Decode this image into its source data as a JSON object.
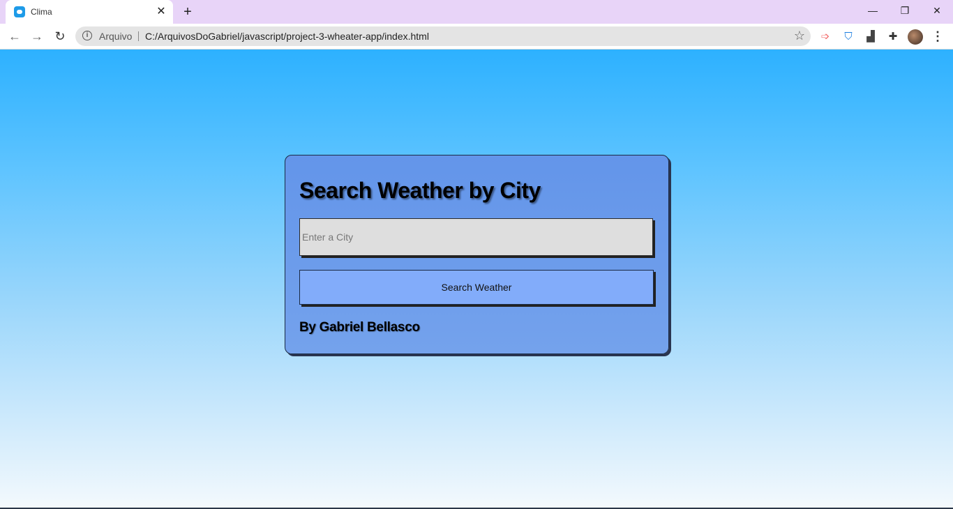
{
  "browser": {
    "tab_title": "Clima",
    "tab_close": "✕",
    "new_tab": "+",
    "window_controls": {
      "minimize": "—",
      "restore": "❐",
      "close": "✕"
    },
    "nav": {
      "back": "←",
      "forward": "→",
      "reload": "↻"
    },
    "site_label": "Arquivo",
    "url": "C:/ArquivosDoGabriel/javascript/project-3-wheater-app/index.html",
    "star": "☆",
    "menu": "⋮"
  },
  "page": {
    "title": "Search Weather by City",
    "input_placeholder": "Enter a City",
    "button_label": "Search Weather",
    "byline": "By Gabriel Bellasco"
  },
  "colors": {
    "tabstrip": "#e8d4f8",
    "background_top": "#2db1ff",
    "card": "#6395ea",
    "button": "#82acfa"
  }
}
